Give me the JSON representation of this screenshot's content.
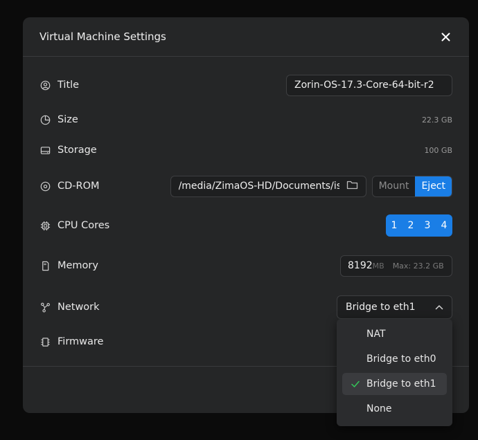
{
  "dialog": {
    "title": "Virtual Machine Settings"
  },
  "rows": {
    "title": {
      "label": "Title",
      "value": "Zorin-OS-17.3-Core-64-bit-r2",
      "icon": "user-circle-icon"
    },
    "size": {
      "label": "Size",
      "value": "22.3 GB",
      "icon": "pie-chart-icon"
    },
    "storage": {
      "label": "Storage",
      "value": "100 GB",
      "icon": "hard-drive-icon"
    },
    "cdrom": {
      "label": "CD-ROM",
      "path": "/media/ZimaOS-HD/Documents/iso/Zorin-OS",
      "mount_label": "Mount",
      "eject_label": "Eject",
      "icon": "disc-icon"
    },
    "cpu": {
      "label": "CPU Cores",
      "options": [
        "1",
        "2",
        "3",
        "4"
      ],
      "icon": "cpu-icon"
    },
    "memory": {
      "label": "Memory",
      "value": "8192",
      "unit": "MB",
      "max": "Max: 23.2 GB",
      "icon": "memory-card-icon"
    },
    "network": {
      "label": "Network",
      "value": "Bridge to eth1",
      "icon": "network-icon"
    },
    "firmware": {
      "label": "Firmware",
      "icon": "chip-icon"
    }
  },
  "network_dropdown": {
    "options": [
      "NAT",
      "Bridge to eth0",
      "Bridge to eth1",
      "None"
    ],
    "selected": "Bridge to eth1"
  },
  "colors": {
    "accent": "#1a7ee6",
    "dialog_bg": "#252627",
    "check": "#34c759"
  }
}
